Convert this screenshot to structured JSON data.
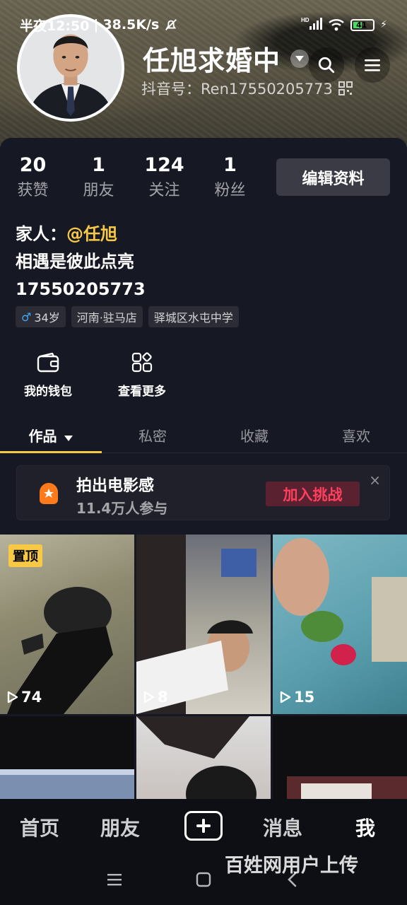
{
  "status_bar": {
    "time": "半夜12:50",
    "speed": "38.5K/s",
    "battery": "41"
  },
  "profile": {
    "name": "任旭求婚中",
    "douyin_id": "抖音号：Ren17550205773",
    "stats": [
      {
        "num": "20",
        "label": "获赞"
      },
      {
        "num": "1",
        "label": "朋友"
      },
      {
        "num": "124",
        "label": "关注"
      },
      {
        "num": "1",
        "label": "粉丝"
      }
    ],
    "edit_label": "编辑资料",
    "bio": {
      "line1_prefix": "家人：",
      "line1_mention": "@任旭",
      "line2": "相遇是彼此点亮",
      "line3": "17550205773"
    },
    "tags": {
      "gender_symbol": "♂",
      "age": "34岁",
      "location": "河南·驻马店",
      "school": "驿城区水屯中学"
    }
  },
  "quick_actions": {
    "wallet": "我的钱包",
    "more": "查看更多"
  },
  "tabs": [
    "作品",
    "私密",
    "收藏",
    "喜欢"
  ],
  "challenge": {
    "title": "拍出电影感",
    "subtitle": "11.4万人参与",
    "join": "加入挑战",
    "close": "×"
  },
  "videos": [
    {
      "plays": "74",
      "pinned_label": "置顶"
    },
    {
      "plays": "8"
    },
    {
      "plays": "15"
    }
  ],
  "bottom_nav": {
    "home": "首页",
    "friends": "朋友",
    "messages": "消息",
    "me": "我",
    "watermark": "百姓网用户上传"
  },
  "colors": {
    "accent_yellow": "#f8c945",
    "challenge_red": "#ff3f5e",
    "background": "#161823"
  }
}
